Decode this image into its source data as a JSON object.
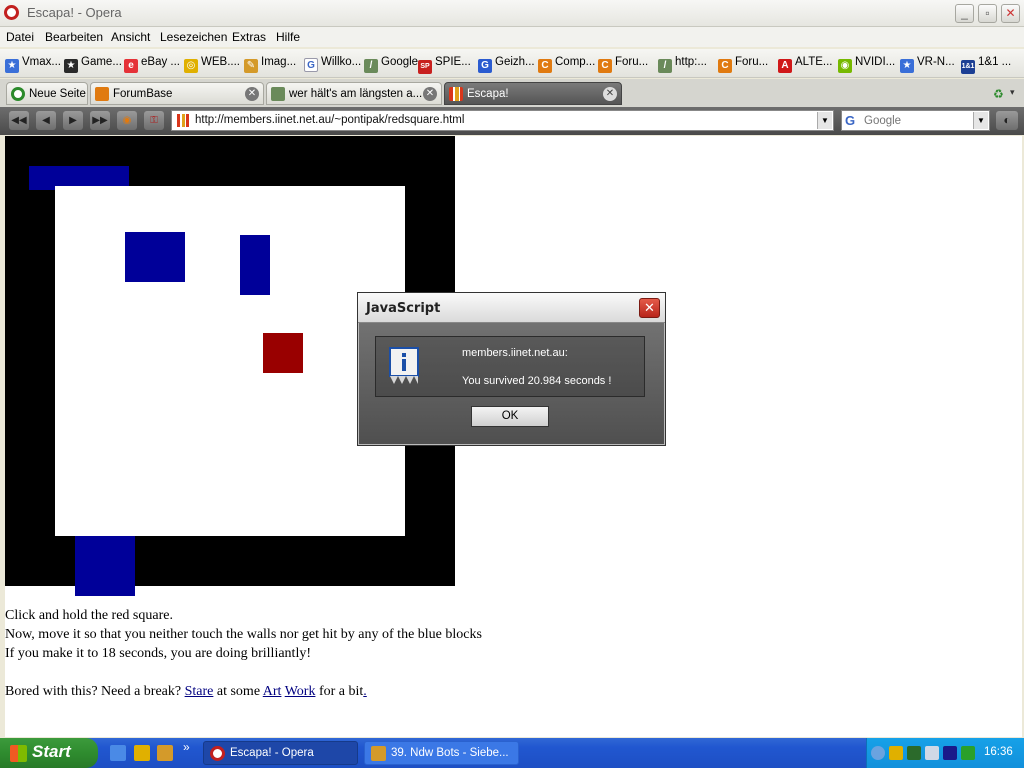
{
  "window": {
    "title": "Escapa! - Opera",
    "controls": {
      "minimize": "_",
      "maximize": "▫",
      "close": "✕"
    }
  },
  "menu": [
    "Datei",
    "Bearbeiten",
    "Ansicht",
    "Lesezeichen",
    "Extras",
    "Hilfe"
  ],
  "bookmarks": [
    "Vmax...",
    "Game...",
    "eBay ...",
    "WEB....",
    "Imag...",
    "Willko...",
    "Google",
    "SPIE...",
    "Geizh...",
    "Comp...",
    "Foru...",
    "http:...",
    "Foru...",
    "ALTE...",
    "NVIDI...",
    "VR-N...",
    "1&1 ..."
  ],
  "tabs": {
    "speed_dial": "Neue Seite",
    "items": [
      {
        "label": "ForumBase",
        "active": false
      },
      {
        "label": "wer hält's am längsten a...",
        "active": false
      },
      {
        "label": "Escapa!",
        "active": true
      }
    ]
  },
  "address": {
    "url": "http://members.iinet.net.au/~pontipak/redsquare.html",
    "search_placeholder": "Google"
  },
  "page": {
    "instructions": [
      "Click and hold the red square.",
      "Now, move it so that you neither touch the walls nor get hit by any of the blue blocks",
      "If you make it to 18 seconds, you are doing brilliantly!"
    ],
    "bored": {
      "prefix": "Bored with this? Need a break?",
      "link_stare": "Stare",
      "mid": "at some",
      "link_art": "Art",
      "link_work": "Work",
      "suffix": "for a bit",
      "link_dot": "."
    }
  },
  "dialog": {
    "title": "JavaScript",
    "host": "members.iinet.net.au:",
    "message": "You survived 20.984 seconds !",
    "ok": "OK"
  },
  "taskbar": {
    "start": "Start",
    "tasks": [
      {
        "label": "Escapa! - Opera",
        "active": true
      },
      {
        "label": "39. Ndw Bots - Siebe...",
        "active": false
      }
    ],
    "clock": "16:36"
  },
  "colors": {
    "board": "#000000",
    "blue_block": "#000099",
    "red_square": "#990000"
  }
}
